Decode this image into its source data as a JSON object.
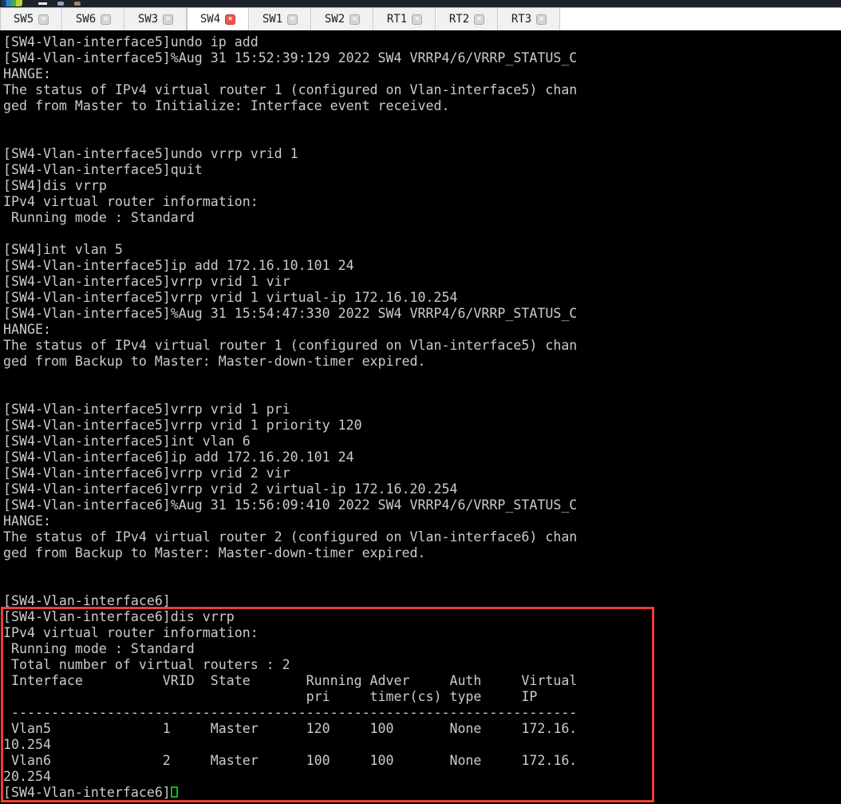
{
  "colors": {
    "terminal_background": "#000000",
    "terminal_text": "#cbcbcb",
    "highlight_red": "#ee3d36",
    "cursor_green": "#12b41c",
    "active_close_red": "#e8584e"
  },
  "icons": {
    "close_glyph": "×"
  },
  "tabs": [
    {
      "label": "SW5",
      "active": false
    },
    {
      "label": "SW6",
      "active": false
    },
    {
      "label": "SW3",
      "active": false
    },
    {
      "label": "SW4",
      "active": true
    },
    {
      "label": "SW1",
      "active": false
    },
    {
      "label": "SW2",
      "active": false
    },
    {
      "label": "RT1",
      "active": false
    },
    {
      "label": "RT2",
      "active": false
    },
    {
      "label": "RT3",
      "active": false
    }
  ],
  "terminal": {
    "lines": [
      "[SW4-Vlan-interface5]undo ip add",
      "[SW4-Vlan-interface5]%Aug 31 15:52:39:129 2022 SW4 VRRP4/6/VRRP_STATUS_C",
      "HANGE:",
      "The status of IPv4 virtual router 1 (configured on Vlan-interface5) chan",
      "ged from Master to Initialize: Interface event received.",
      "",
      "",
      "[SW4-Vlan-interface5]undo vrrp vrid 1",
      "[SW4-Vlan-interface5]quit",
      "[SW4]dis vrrp",
      "IPv4 virtual router information:",
      " Running mode : Standard",
      "",
      "[SW4]int vlan 5",
      "[SW4-Vlan-interface5]ip add 172.16.10.101 24",
      "[SW4-Vlan-interface5]vrrp vrid 1 vir",
      "[SW4-Vlan-interface5]vrrp vrid 1 virtual-ip 172.16.10.254",
      "[SW4-Vlan-interface5]%Aug 31 15:54:47:330 2022 SW4 VRRP4/6/VRRP_STATUS_C",
      "HANGE:",
      "The status of IPv4 virtual router 1 (configured on Vlan-interface5) chan",
      "ged from Backup to Master: Master-down-timer expired.",
      "",
      "",
      "[SW4-Vlan-interface5]vrrp vrid 1 pri",
      "[SW4-Vlan-interface5]vrrp vrid 1 priority 120",
      "[SW4-Vlan-interface5]int vlan 6",
      "[SW4-Vlan-interface6]ip add 172.16.20.101 24",
      "[SW4-Vlan-interface6]vrrp vrid 2 vir",
      "[SW4-Vlan-interface6]vrrp vrid 2 virtual-ip 172.16.20.254",
      "[SW4-Vlan-interface6]%Aug 31 15:56:09:410 2022 SW4 VRRP4/6/VRRP_STATUS_C",
      "HANGE:",
      "The status of IPv4 virtual router 2 (configured on Vlan-interface6) chan",
      "ged from Backup to Master: Master-down-timer expired.",
      "",
      "",
      "[SW4-Vlan-interface6]",
      "[SW4-Vlan-interface6]dis vrrp",
      "IPv4 virtual router information:",
      " Running mode : Standard",
      " Total number of virtual routers : 2",
      " Interface          VRID  State       Running Adver     Auth     Virtual",
      "                                      pri     timer(cs) type     IP",
      " -----------------------------------------------------------------------",
      " Vlan5              1     Master      120     100       None     172.16.",
      "10.254",
      " Vlan6              2     Master      100     100       None     172.16.",
      "20.254",
      "[SW4-Vlan-interface6]"
    ],
    "vrrp_summary": {
      "running_mode": "Standard",
      "total_virtual_routers": "2",
      "columns": [
        "Interface",
        "VRID",
        "State",
        "Running pri",
        "Adver timer(cs)",
        "Auth type",
        "Virtual IP"
      ],
      "rows": [
        [
          "Vlan5",
          "1",
          "Master",
          "120",
          "100",
          "None",
          "172.16.10.254"
        ],
        [
          "Vlan6",
          "2",
          "Master",
          "100",
          "100",
          "None",
          "172.16.20.254"
        ]
      ]
    },
    "prompt": "[SW4-Vlan-interface6]"
  }
}
